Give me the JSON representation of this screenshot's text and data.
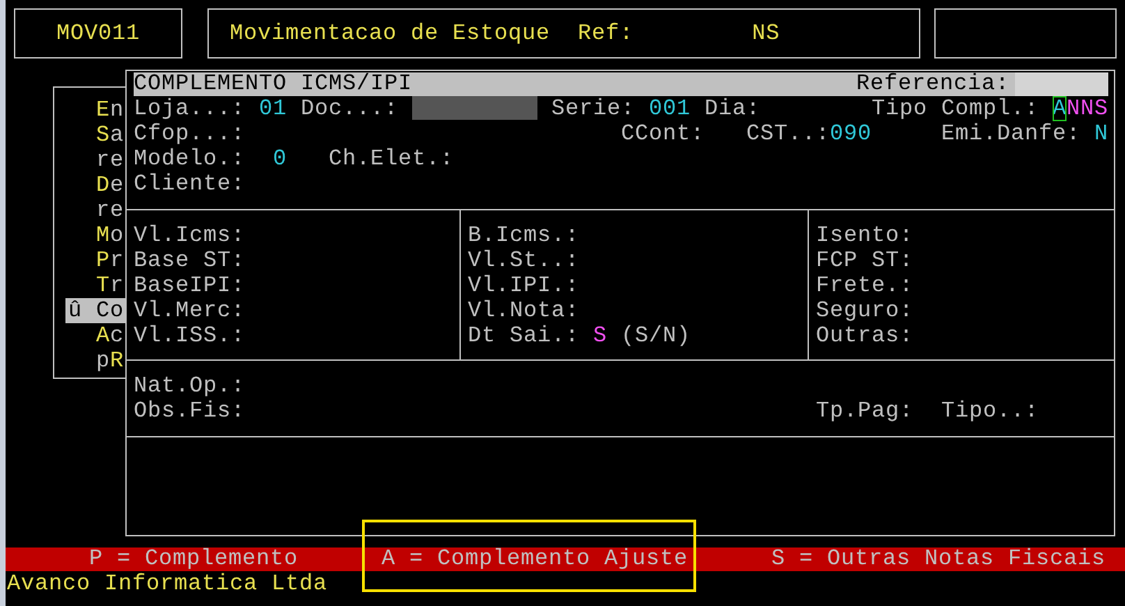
{
  "top_bar": {
    "program_code": "MOV011",
    "title": "Movimentacao de Estoque",
    "ref_label": "Ref:",
    "ref_value": "NS"
  },
  "menu": {
    "items": [
      {
        "key": "E",
        "post": "n",
        "selected": false
      },
      {
        "key": "S",
        "post": "a",
        "selected": false
      },
      {
        "pre": "re",
        "selected": false
      },
      {
        "key": "D",
        "post": "e",
        "selected": false
      },
      {
        "pre": "re",
        "selected": false
      },
      {
        "key": "M",
        "post": "o",
        "selected": false
      },
      {
        "key": "P",
        "post": "r",
        "selected": false
      },
      {
        "key": "T",
        "post": "r",
        "selected": false
      },
      {
        "pre": "û Co",
        "selected": true
      },
      {
        "key": "A",
        "post": "c",
        "selected": false
      },
      {
        "pre": "p",
        "key": "R",
        "selected": false
      }
    ]
  },
  "dialog": {
    "title": "COMPLEMENTO ICMS/IPI",
    "reference_label": "Referencia:",
    "header": {
      "loja_label": "Loja...:",
      "loja": "01",
      "doc_label": "Doc...:",
      "serie_label": "Serie:",
      "serie": "001",
      "dia_label": "Dia:",
      "tipo_label": "Tipo",
      "compl_label": "Compl.:",
      "compl_cursor": "A",
      "compl_rest": "NNS",
      "cfop_label": "Cfop...:",
      "ccont_label": "CCont:",
      "cst_label": "CST..:",
      "cst": "090",
      "emi_label": "Emi.Danfe:",
      "emi": "N",
      "modelo_label": "Modelo.:",
      "modelo": "0",
      "chelet_label": "Ch.Elet.:",
      "cliente_label": "Cliente:"
    },
    "totals": [
      {
        "fields": [
          {
            "label": "Vl.Icms:"
          },
          {
            "label": "Base ST:"
          },
          {
            "label": "BaseIPI:"
          },
          {
            "label": "Vl.Merc:"
          },
          {
            "label": "Vl.ISS.:"
          }
        ]
      },
      {
        "fields": [
          {
            "label": "B.Icms.:"
          },
          {
            "label": "Vl.St..:"
          },
          {
            "label": "Vl.IPI.:"
          },
          {
            "label": "Vl.Nota:"
          },
          {
            "label": "Dt Sai.:",
            "value": "S",
            "hint": "(S/N)"
          }
        ]
      },
      {
        "fields": [
          {
            "label": "Isento:"
          },
          {
            "label": "FCP ST:"
          },
          {
            "label": "Frete.:"
          },
          {
            "label": "Seguro:"
          },
          {
            "label": "Outras:"
          }
        ]
      }
    ],
    "footer": {
      "natop_label": "Nat.Op.:",
      "obs_label": "Obs.Fis:",
      "tppag_label": "Tp.Pag:",
      "tipo_label": "Tipo..:"
    }
  },
  "status_bar": [
    "P = Complemento",
    "A = Complemento Ajuste",
    "S = Outras Notas Fiscais"
  ],
  "company": "Avanco Informatica Ltda"
}
